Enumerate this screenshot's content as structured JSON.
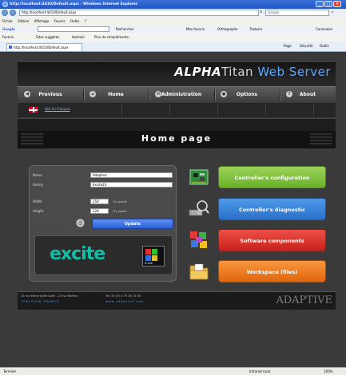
{
  "window": {
    "title": "http://localhost:4410/Default.aspx - Windows Internet Explorer",
    "url": "http://localhost:4410/Default.aspx",
    "search_placeholder": "Google"
  },
  "menubar": [
    "Fichier",
    "Edition",
    "Affichage",
    "Favoris",
    "Outils",
    "?"
  ],
  "googlebar": {
    "label": "Google",
    "items": [
      "Rechercher",
      "Mes favoris",
      "Orthographe",
      "Traduire",
      "Connexion"
    ]
  },
  "favbar": {
    "label": "Favoris",
    "items": [
      "Sites suggérés",
      "Hotmail",
      "Plus de compléments..."
    ]
  },
  "tab": {
    "label": "http://localhost:4410/Default.aspx"
  },
  "tab_tools": [
    "Page",
    "Sécurité",
    "Outils"
  ],
  "header": {
    "brand_alpha": "ALPHA",
    "brand_titan": "Titan",
    "brand_web": " Web Server"
  },
  "nav": {
    "previous": "Previous",
    "home": "Home",
    "administration": "Administration",
    "options": "Options",
    "about": "About"
  },
  "lang": {
    "link": "Voir en Français"
  },
  "page_title": "Home page",
  "form": {
    "name_label": "Name",
    "name_value": "Adaptive",
    "family_label": "Family",
    "family_value": "Excite23",
    "width_label": "Width",
    "width_value": "250",
    "width_unit": "(X) pixels",
    "height_label": "Height",
    "height_value": "128",
    "height_unit": "(Y) pixels",
    "update_label": "Update"
  },
  "logo": {
    "text": "excite",
    "chip_text": "Z-Lite"
  },
  "actions": [
    {
      "label": "Controller's configuration",
      "color": "#7dc13a"
    },
    {
      "label": "Controller's diagnostic",
      "color": "#2f7fd6"
    },
    {
      "label": "Software components",
      "color": "#d9322a"
    },
    {
      "label": "Workspace (files)",
      "color": "#f07a1a"
    }
  ],
  "footer": {
    "address": "23 rue Edme Jallet Gaté - 23 Ivo Ruérez",
    "tagline": "TOULOUSE  FRANCE",
    "phone": "Tel: 33 (0) 4 79 26 76 00",
    "web": "www.adaptive.com",
    "brand": "ADAPTIVE"
  },
  "status": {
    "left": "Terminé",
    "zone": "Intranet local",
    "zoom": "100%"
  }
}
